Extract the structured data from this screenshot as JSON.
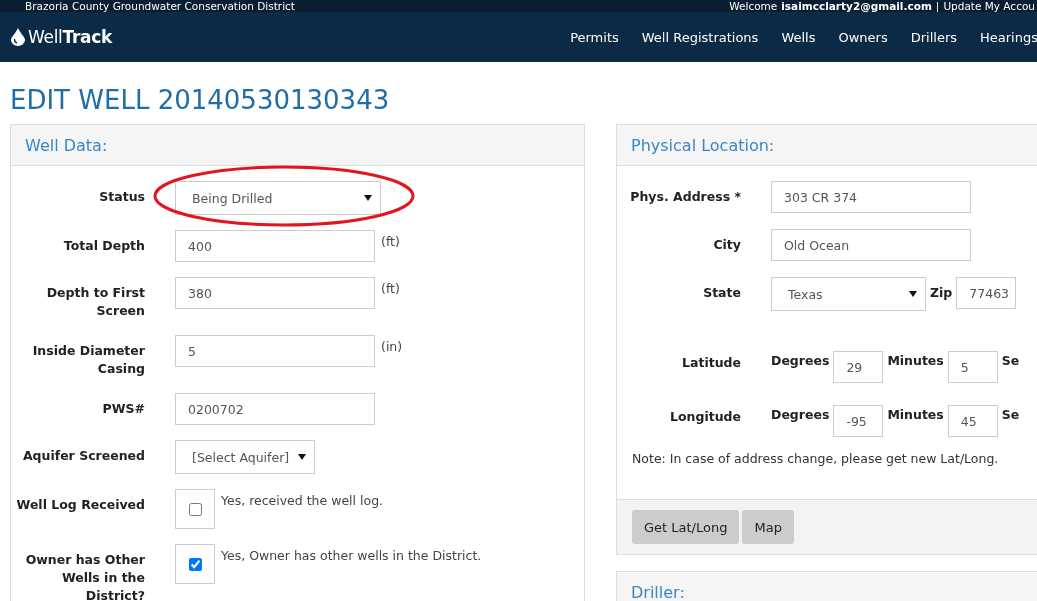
{
  "header": {
    "district": "Brazoria County Groundwater Conservation District",
    "welcome": "Welcome",
    "email": "isaimcclarty2@gmail.com",
    "separator": "|",
    "account_link": "Update My Accou"
  },
  "nav": {
    "logo_light": "Well",
    "logo_bold": "Track",
    "items": [
      "Permits",
      "Well Registrations",
      "Wells",
      "Owners",
      "Drillers",
      "Hearings"
    ]
  },
  "page_title": "EDIT WELL 20140530130343",
  "well_data": {
    "title": "Well Data:",
    "fields": [
      {
        "kind": "select",
        "label": "Status",
        "value": "Being Drilled",
        "highlighted": true
      },
      {
        "kind": "text",
        "label": "Total Depth",
        "value": "400",
        "unit": "(ft)"
      },
      {
        "kind": "text",
        "label": "Depth to First Screen",
        "value": "380",
        "unit": "(ft)"
      },
      {
        "kind": "text",
        "label": "Inside Diameter Casing",
        "value": "5",
        "unit": "(in)"
      },
      {
        "kind": "text",
        "label": "PWS#",
        "value": "0200702"
      },
      {
        "kind": "select",
        "label": "Aquifer Screened",
        "value": "[Select Aquifer]",
        "highlighted": false
      },
      {
        "kind": "checkbox",
        "label": "Well Log Received",
        "text": "Yes, received the well log.",
        "checked": false
      },
      {
        "kind": "checkbox",
        "label": "Owner has Other Wells in the District?",
        "text": "Yes, Owner has other wells in the District.",
        "checked": true
      }
    ]
  },
  "physical_location": {
    "title": "Physical Location:",
    "rows": [
      {
        "kind": "text",
        "label": "Phys. Address *",
        "value": "303 CR 374"
      },
      {
        "kind": "text",
        "label": "City",
        "value": "Old Ocean"
      },
      {
        "kind": "state_zip",
        "label": "State",
        "value": "Texas",
        "zip_label": "Zip",
        "zip": "77463"
      },
      {
        "kind": "coords",
        "label": "Latitude",
        "degrees_label": "Degrees",
        "degrees": "29",
        "minutes_label": "Minutes",
        "minutes": "5",
        "seconds_label": "Se"
      },
      {
        "kind": "coords",
        "label": "Longitude",
        "degrees_label": "Degrees",
        "degrees": "-95",
        "minutes_label": "Minutes",
        "minutes": "45",
        "seconds_label": "Se"
      }
    ],
    "note": "Note: In case of address change, please get new Lat/Long.",
    "buttons": [
      "Get Lat/Long",
      "Map"
    ]
  },
  "driller": {
    "title": "Driller:"
  }
}
